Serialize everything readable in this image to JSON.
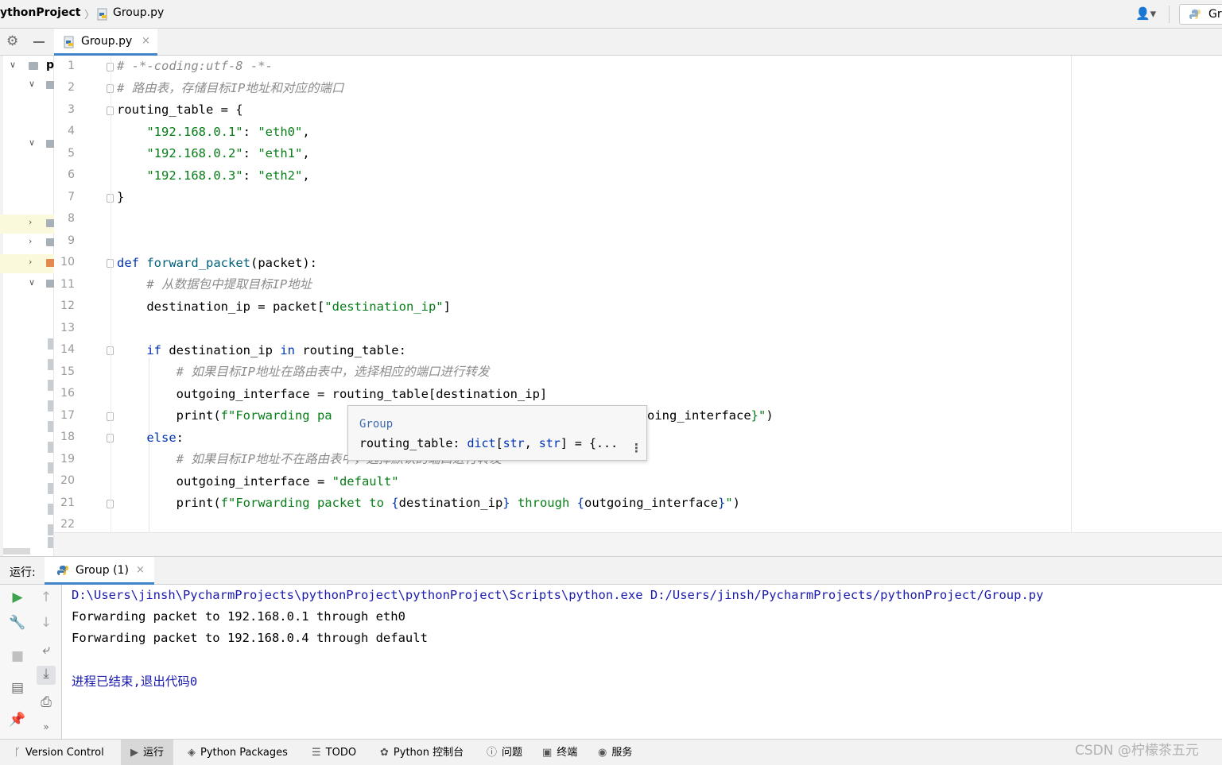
{
  "navbar": {
    "project": "ythonProject",
    "separator": "〉",
    "file": "Group.py",
    "run_config": "Gr"
  },
  "tabbar": {
    "tab_label": "Group.py",
    "close": "×"
  },
  "project_panel": {
    "label": "p"
  },
  "editor": {
    "line_numbers": [
      "1",
      "2",
      "3",
      "4",
      "5",
      "6",
      "7",
      "8",
      "9",
      "10",
      "11",
      "12",
      "13",
      "14",
      "15",
      "16",
      "17",
      "18",
      "19",
      "20",
      "21",
      "22"
    ]
  },
  "code": {
    "l1": "# -*-coding:utf-8 -*-",
    "l2": "# 路由表，存储目标IP地址和对应的端口",
    "l3": "routing_table = {",
    "l4_key": "\"192.168.0.1\"",
    "l4_val": "\"eth0\"",
    "l5_key": "\"192.168.0.2\"",
    "l5_val": "\"eth1\"",
    "l6_key": "\"192.168.0.3\"",
    "l6_val": "\"eth2\"",
    "l7": "}",
    "l10_def": "def",
    "l10_name": "forward_packet",
    "l10_rest": "(packet):",
    "l11": "# 从数据包中提取目标IP地址",
    "l12_a": "destination_ip = packet[",
    "l12_str": "\"destination_ip\"",
    "l12_b": "]",
    "l14_if": "if",
    "l14_a": " destination_ip ",
    "l14_in": "in",
    "l14_b": " routing_table:",
    "l15": "# 如果目标IP地址在路由表中，选择相应的端口进行转发",
    "l16": "outgoing_interface = routing_table[destination_ip]",
    "l17_a": "print(",
    "l17_str": "f\"Forwarding pa",
    "l17_tail_str": "oing_interface",
    "l17_tail_b": "}\"",
    "l17_close": ")",
    "l18": "else",
    "l18_b": ":",
    "l19": "# 如果目标IP地址不在路由表中，选择默认的端口进行转发",
    "l20_a": "outgoing_interface = ",
    "l20_str": "\"default\"",
    "l21_a": "print(",
    "l21_s1": "f\"Forwarding packet to ",
    "l21_b1": "{",
    "l21_v1": "destination_ip",
    "l21_b2": "}",
    "l21_s2": " through ",
    "l21_b3": "{",
    "l21_v2": "outgoing_interface",
    "l21_b4": "}",
    "l21_s3": "\"",
    "l21_close": ")"
  },
  "tooltip": {
    "module": "Group",
    "sig_name": "routing_table: ",
    "sig_type1": "dict",
    "sig_b1": "[",
    "sig_type2": "str",
    "sig_comma": ", ",
    "sig_type3": "str",
    "sig_b2": "] = {...",
    "more": "⋮"
  },
  "run_panel": {
    "title": "运行:",
    "tab_label": "Group (1)",
    "close": "×"
  },
  "console": {
    "cmd": "D:\\Users\\jinsh\\PycharmProjects\\pythonProject\\pythonProject\\Scripts\\python.exe D:/Users/jinsh/PycharmProjects/pythonProject/Group.py",
    "out1": "Forwarding packet to 192.168.0.1 through eth0",
    "out2": "Forwarding packet to 192.168.0.4 through default",
    "exit": "进程已结束,退出代码0"
  },
  "statusbar": {
    "items": [
      "Version Control",
      "运行",
      "Python Packages",
      "TODO",
      "Python 控制台",
      "问题",
      "终端",
      "服务"
    ]
  },
  "watermark": "CSDN @柠檬茶五元",
  "colors": {
    "keyword": "#0033b3",
    "function": "#00627a",
    "string": "#067d17",
    "comment": "#8c8c8c",
    "accent": "#4083c9"
  }
}
